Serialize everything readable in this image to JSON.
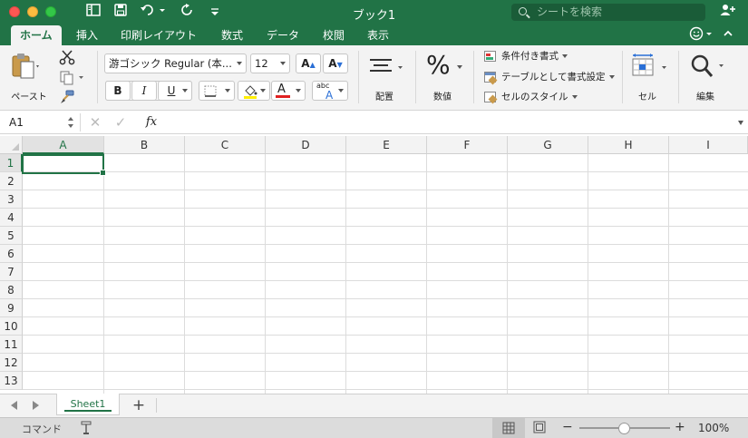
{
  "window": {
    "title": "ブック1"
  },
  "search": {
    "placeholder": "シートを検索"
  },
  "tabs": [
    {
      "label": "ホーム",
      "active": true
    },
    {
      "label": "挿入"
    },
    {
      "label": "印刷レイアウト"
    },
    {
      "label": "数式"
    },
    {
      "label": "データ"
    },
    {
      "label": "校閲"
    },
    {
      "label": "表示"
    }
  ],
  "ribbon": {
    "paste_label": "ペースト",
    "font_name": "游ゴシック Regular (本...",
    "font_size": "12",
    "bold": "B",
    "italic": "I",
    "underline": "U",
    "font_color_glyph": "A",
    "grow_font": "A",
    "shrink_font": "A",
    "phonetic": "abc",
    "align_label": "配置",
    "number_label": "数値",
    "number_glyph": "%",
    "conditional_format": "条件付き書式",
    "format_as_table": "テーブルとして書式設定",
    "cell_styles": "セルのスタイル",
    "cells_label": "セル",
    "edit_label": "編集"
  },
  "formula_bar": {
    "name_box": "A1",
    "fx": "fx",
    "value": ""
  },
  "grid": {
    "columns": [
      "A",
      "B",
      "C",
      "D",
      "E",
      "F",
      "G",
      "H",
      "I"
    ],
    "rows": [
      "1",
      "2",
      "3",
      "4",
      "5",
      "6",
      "7",
      "8",
      "9",
      "10",
      "11",
      "12",
      "13"
    ],
    "selected_cell": "A1"
  },
  "sheets": [
    {
      "name": "Sheet1",
      "active": true
    }
  ],
  "add_sheet": "+",
  "status": {
    "mode": "コマンド",
    "zoom": "100%",
    "zoom_minus": "−",
    "zoom_plus": "+"
  },
  "colors": {
    "accent": "#217346",
    "ribbon_bg": "#f3f3f3"
  }
}
